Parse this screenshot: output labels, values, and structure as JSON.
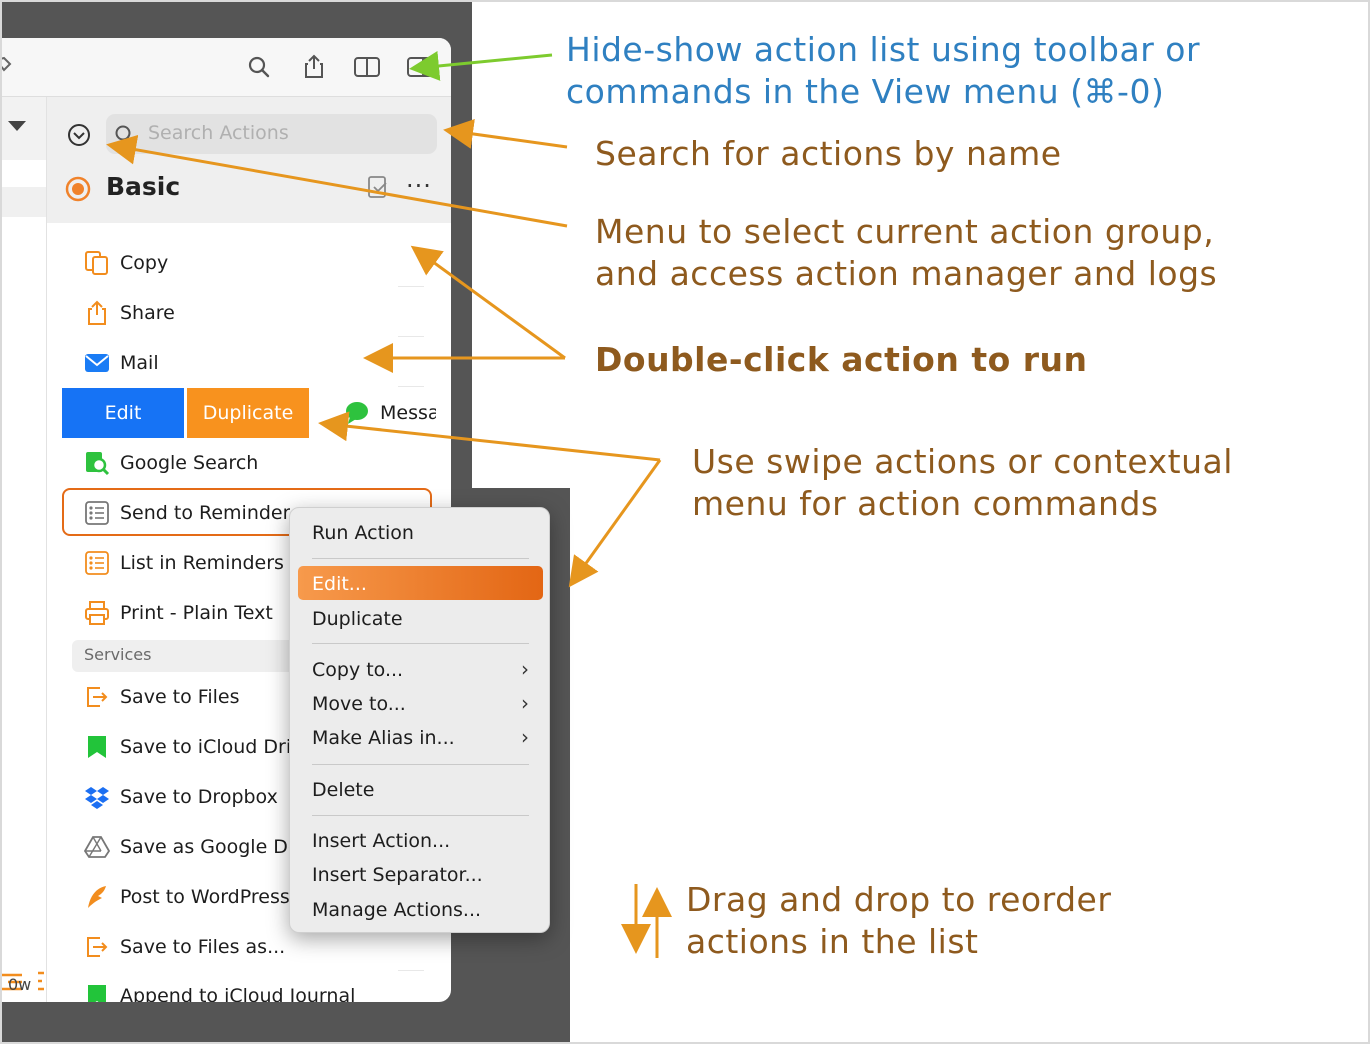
{
  "window": {
    "search_placeholder": "Search Actions",
    "group_title": "Basic",
    "left_strip_bottom": "0w"
  },
  "actions": [
    {
      "label": "Copy",
      "icon": "copy-icon"
    },
    {
      "label": "Share",
      "icon": "share-icon"
    },
    {
      "label": "Mail",
      "icon": "mail-icon"
    },
    {
      "label": "Messa",
      "icon": "message-icon"
    },
    {
      "label": "Google Search",
      "icon": "google-search-icon"
    },
    {
      "label": "Send to Reminders",
      "icon": "reminders-icon"
    },
    {
      "label": "List in Reminders",
      "icon": "reminders-list-icon"
    },
    {
      "label": "Print - Plain Text",
      "icon": "print-icon"
    }
  ],
  "services_header": "Services",
  "services": [
    {
      "label": "Save to Files",
      "icon": "files-icon"
    },
    {
      "label": "Save to iCloud Dri",
      "icon": "icloud-drive-icon"
    },
    {
      "label": "Save to Dropbox",
      "icon": "dropbox-icon"
    },
    {
      "label": "Save as Google Do",
      "icon": "google-drive-icon"
    },
    {
      "label": "Post to WordPress",
      "icon": "wordpress-icon"
    },
    {
      "label": "Save to Files as...",
      "icon": "files-icon"
    },
    {
      "label": "Append to iCloud Journal",
      "icon": "icloud-journal-icon"
    }
  ],
  "swipe": {
    "edit": "Edit",
    "duplicate": "Duplicate"
  },
  "context_menu": {
    "run": "Run Action",
    "edit": "Edit...",
    "duplicate": "Duplicate",
    "copy_to": "Copy to...",
    "move_to": "Move to...",
    "alias": "Make Alias in...",
    "delete": "Delete",
    "insert_action": "Insert Action...",
    "insert_separator": "Insert Separator...",
    "manage": "Manage Actions..."
  },
  "notes": {
    "toolbar_1": "Hide-show action list using toolbar or",
    "toolbar_2": "commands in the View menu (⌘-0)",
    "search": "Search for actions by name",
    "menu_1": "Menu to select current action group,",
    "menu_2": "and access action manager and logs",
    "double_click": "Double-click action to run",
    "swipe_1": "Use swipe actions or contextual",
    "swipe_2": "menu for action commands",
    "drag_1": "Drag and drop to reorder",
    "drag_2": "actions in the list"
  },
  "colors": {
    "note_blue": "#2f80c1",
    "note_brown": "#8e5a1e",
    "arrow_orange": "#e6961e",
    "arrow_green": "#7dcb2e",
    "accent_orange": "#f8921e",
    "accent_blue": "#1673f5"
  }
}
